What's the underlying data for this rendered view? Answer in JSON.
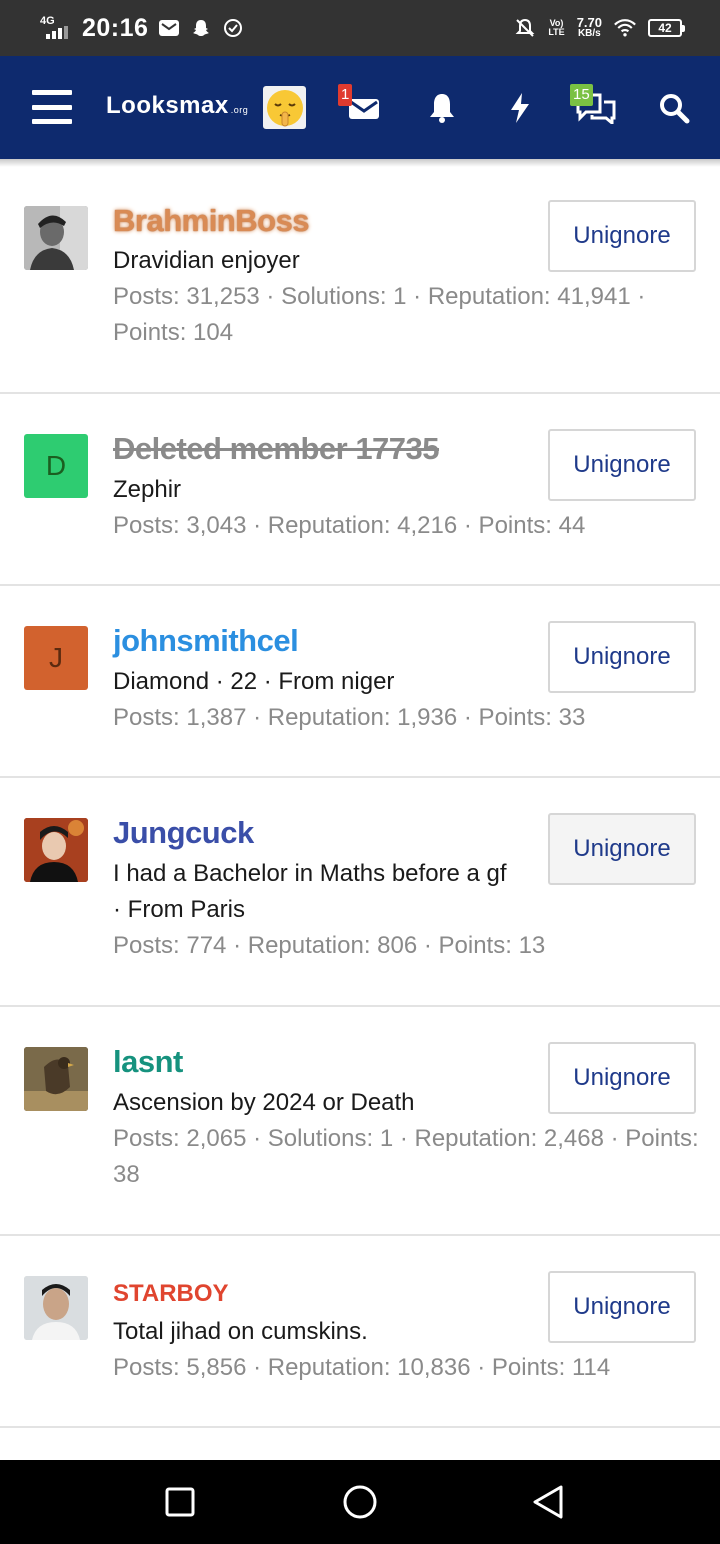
{
  "status_bar": {
    "network": "4G",
    "time": "20:16",
    "lte_top": "Vo)",
    "lte_bottom": "LTE",
    "speed": "7.70",
    "speed_unit": "KB/s",
    "battery": "42"
  },
  "header": {
    "logo_main": "Looksmax",
    "logo_suffix": ".org",
    "inbox_badge": "1",
    "chat_badge": "15"
  },
  "members": [
    {
      "name": "BrahminBoss",
      "name_color": "#d98b55",
      "name_style": "glow",
      "title": "Dravidian enjoyer",
      "stats": "Posts: 31,253 · Solutions: 1 · Reputation: 41,941 · Points: 104",
      "avatar": "photo-man",
      "button": "Unignore"
    },
    {
      "name": "Deleted member 17735",
      "name_color": "#8a8a8a",
      "name_style": "strike",
      "title": "Zephir",
      "stats": "Posts: 3,043 · Reputation: 4,216 · Points: 44",
      "avatar": "D",
      "avatar_bg": "#2ecc71",
      "avatar_fg": "#1b5e20",
      "button": "Unignore"
    },
    {
      "name": "johnsmithcel",
      "name_color": "#2b8fe0",
      "name_style": "plain",
      "title": "Diamond · 22 · From niger",
      "stats": "Posts: 1,387 · Reputation: 1,936 · Points: 33",
      "avatar": "J",
      "avatar_bg": "#d2622e",
      "avatar_fg": "#5a2a10",
      "button": "Unignore"
    },
    {
      "name": "Jungcuck",
      "name_color": "#3a4ea8",
      "name_style": "plain",
      "title": "I had a Bachelor in Maths before a gf · From Paris",
      "stats": "Posts: 774 · Reputation: 806 · Points: 13",
      "avatar": "photo-kpop",
      "button": "Unignore"
    },
    {
      "name": "lasnt",
      "name_color": "#16927e",
      "name_style": "plain",
      "title": "Ascension by 2024 or Death",
      "stats": "Posts: 2,065 · Solutions: 1 · Reputation: 2,468 · Points: 38",
      "avatar": "photo-bird",
      "button": "Unignore"
    },
    {
      "name": "STARBOY",
      "name_color": "#e0452f",
      "name_style": "plain",
      "title": "Total jihad on cumskins.",
      "stats": "Posts: 5,856 · Reputation: 10,836 · Points: 114",
      "avatar": "photo-selfie",
      "button": "Unignore"
    }
  ]
}
